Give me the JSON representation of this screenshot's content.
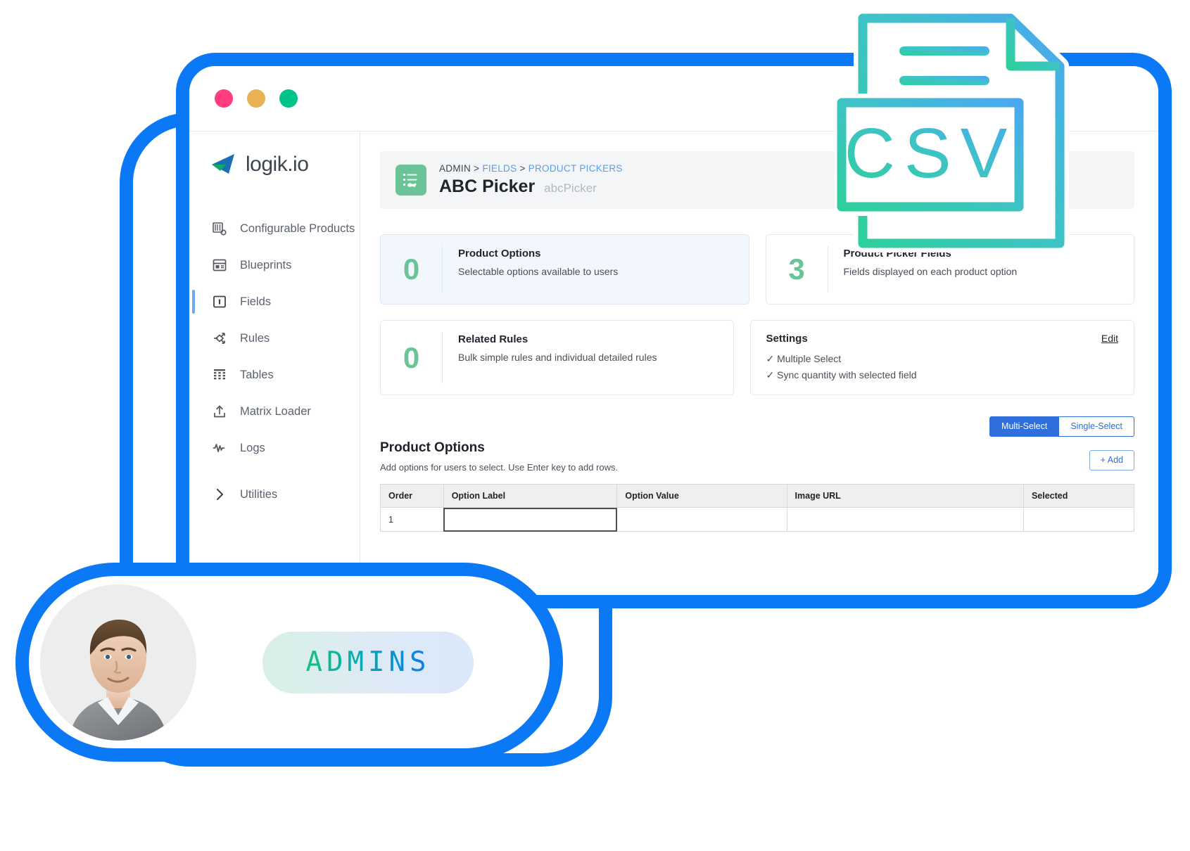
{
  "window": {
    "traffic_lights": [
      {
        "name": "close",
        "color": "#FF3D7F"
      },
      {
        "name": "minimize",
        "color": "#E8B254"
      },
      {
        "name": "maximize",
        "color": "#00C389"
      }
    ]
  },
  "sidebar": {
    "logo_text": "logik.io",
    "items": [
      {
        "label": "Configurable Products",
        "icon": "configurable-products-icon",
        "active": false
      },
      {
        "label": "Blueprints",
        "icon": "blueprints-icon",
        "active": false
      },
      {
        "label": "Fields",
        "icon": "fields-icon",
        "active": true
      },
      {
        "label": "Rules",
        "icon": "rules-icon",
        "active": false
      },
      {
        "label": "Tables",
        "icon": "tables-icon",
        "active": false
      },
      {
        "label": "Matrix Loader",
        "icon": "matrix-loader-icon",
        "active": false
      },
      {
        "label": "Logs",
        "icon": "logs-icon",
        "active": false
      },
      {
        "label": "Utilities",
        "icon": "chevron-right-icon",
        "active": false
      }
    ]
  },
  "header": {
    "breadcrumb": {
      "root": "ADMIN",
      "sep1": ">",
      "link1": "FIELDS",
      "sep2": ">",
      "link2": "PRODUCT PICKERS"
    },
    "title": "ABC Picker",
    "subtitle": "abcPicker",
    "icon": "list-picker-icon",
    "icon_color": "#6BC497"
  },
  "cards": {
    "product_options": {
      "value": "0",
      "title": "Product Options",
      "desc": "Selectable options available to users"
    },
    "product_picker_fields": {
      "value": "3",
      "title": "Product Picker Fields",
      "desc": "Fields displayed on each product option"
    },
    "related_rules": {
      "value": "0",
      "title": "Related Rules",
      "desc": "Bulk simple rules and individual detailed rules"
    },
    "settings": {
      "title": "Settings",
      "edit_label": "Edit",
      "line1": "✓ Multiple Select",
      "line2": "✓ Sync quantity with selected field"
    }
  },
  "options_section": {
    "title": "Product Options",
    "hint": "Add options for users to select. Use Enter key to add rows.",
    "segmented": [
      {
        "label": "Multi-Select",
        "active": true
      },
      {
        "label": "Single-Select",
        "active": false
      }
    ],
    "add_button": "+ Add",
    "columns": [
      "Order",
      "Option Label",
      "Option Value",
      "Image URL",
      "Selected"
    ],
    "rows": [
      {
        "order": "1",
        "option_label": "",
        "option_value": "",
        "image_url": "",
        "selected": ""
      }
    ]
  },
  "csv_badge": {
    "label": "CSV",
    "gradient_start": "#3FD1A0",
    "gradient_end": "#4AA8F0"
  },
  "avatar_pill": {
    "badge_label": "ADMINS",
    "avatar_alt": "user-portrait"
  },
  "colors": {
    "frame_blue": "#0B79F5",
    "accent_green": "#6BC497",
    "link_blue": "#5D9CEC",
    "segment_blue": "#2E6FDB"
  }
}
